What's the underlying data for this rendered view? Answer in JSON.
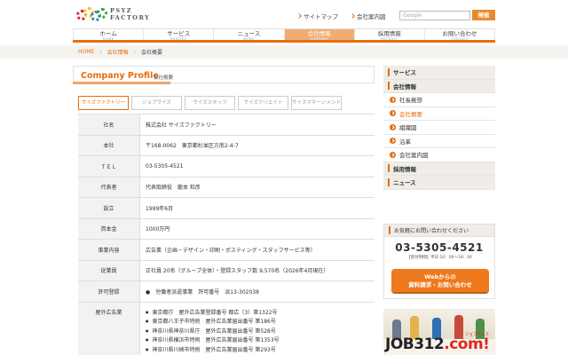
{
  "header": {
    "logo_text_line1": "PSYZ",
    "logo_text_line2": "FACTORY",
    "util_links": [
      "サイトマップ",
      "会社案内図"
    ],
    "search_placeholder": "Google",
    "search_button": "検索"
  },
  "nav": {
    "items": [
      {
        "jp": "ホーム",
        "en": "HOME"
      },
      {
        "jp": "サービス",
        "en": "SERVICE"
      },
      {
        "jp": "ニュース",
        "en": "NEWS"
      },
      {
        "jp": "会社情報",
        "en": "COMPANY"
      },
      {
        "jp": "採用情報",
        "en": "RECRUIT"
      },
      {
        "jp": "お問い合わせ",
        "en": "CONTACT"
      }
    ],
    "active_index": 3
  },
  "breadcrumb": {
    "home": "HOME",
    "sep": "›",
    "section": "会社情報",
    "current": "会社概要"
  },
  "page": {
    "title": "Company Profile",
    "subtitle": "会社概要",
    "tabs": [
      "サイズファクトリー",
      "ジョブサイズ",
      "サイズスタッフ",
      "サイズクリエイト",
      "サイズマネージメント"
    ],
    "active_tab": 0
  },
  "profile": {
    "rows": [
      {
        "label": "社名",
        "value": "株式会社 サイズファクトリー"
      },
      {
        "label": "本社",
        "value": "〒168-0062　東京都杉並区方南2-4-7"
      },
      {
        "label": "ＴＥＬ",
        "value": "03-5305-4521"
      },
      {
        "label": "代表者",
        "value": "代表取締役　龍本 和彦"
      },
      {
        "label": "設立",
        "value": "1999年6月"
      },
      {
        "label": "資本金",
        "value": "1000万円"
      },
      {
        "label": "事業内容",
        "value": "広告業（企画・デザイン・印刷・ポスティング・スタッフサービス等）"
      },
      {
        "label": "従業員",
        "value": "正社員 20名（グループ全体）・登録スタッフ数 9,570名（2026年4月現在）"
      },
      {
        "label": "許可登録",
        "value": "●　労働者派遣事業　許可番号　派13-302038"
      }
    ],
    "ads_label": "屋外広告業",
    "ads_items": [
      "東京都庁　屋外広告業登録番号 都広（3）第1322号",
      "東京都八王子市特例　屋外広告業届出番号 第186号",
      "神奈川県神奈川県庁　屋外広告業届出番号 第528号",
      "神奈川県横浜市特例　屋外広告業届出番号 第1353号",
      "神奈川県川崎市特例　屋外広告業届出番号 第293号"
    ]
  },
  "sidebar": {
    "items": [
      {
        "label": "サービス",
        "type": "major"
      },
      {
        "label": "会社情報",
        "type": "major"
      },
      {
        "label": "社長挨拶",
        "type": "sub"
      },
      {
        "label": "会社概要",
        "type": "sub",
        "current": true
      },
      {
        "label": "組織図",
        "type": "sub"
      },
      {
        "label": "沿革",
        "type": "sub"
      },
      {
        "label": "会社案内図",
        "type": "sub"
      },
      {
        "label": "採用情報",
        "type": "major"
      },
      {
        "label": "ニュース",
        "type": "major"
      }
    ]
  },
  "contact": {
    "heading": "お気軽にお問い合わせください",
    "phone": "03-5305-4521",
    "hours": "【受付時間】平日 10：00～18：00",
    "web_line1": "Webからの",
    "web_line2": "資料請求・お問い合わせ"
  },
  "banner": {
    "logo_main": "JOB312",
    "logo_com": ".com",
    "logo_exclaim": "!",
    "tag": "ジョブサイズ"
  },
  "colors": {
    "accent": "#e66e0f",
    "nav_active": "#f0ad73",
    "table_header_bg": "#f2f2f2"
  }
}
